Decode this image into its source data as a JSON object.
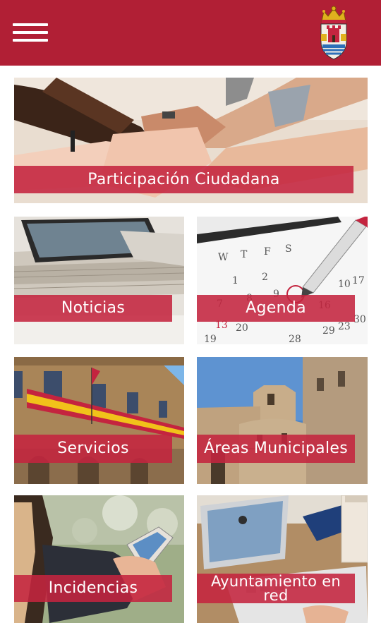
{
  "header": {
    "menu_icon": "hamburger-menu-icon",
    "crest_icon": "municipal-coat-of-arms-icon",
    "bar_color": "#b11f35"
  },
  "tiles": [
    {
      "label": "Participación Ciudadana",
      "image": "joined-hands"
    },
    {
      "label": "Noticias",
      "image": "tablet-on-newspapers"
    },
    {
      "label": "Agenda",
      "image": "calendar-with-pen"
    },
    {
      "label": "Servicios",
      "image": "town-hall-facade-with-flags"
    },
    {
      "label": "Áreas Municipales",
      "image": "romanesque-church"
    },
    {
      "label": "Incidencias",
      "image": "hand-holding-phone"
    },
    {
      "label": "Ayuntamiento en red",
      "image": "desk-with-laptop-and-notebook"
    }
  ],
  "label_color": "#c4243f"
}
